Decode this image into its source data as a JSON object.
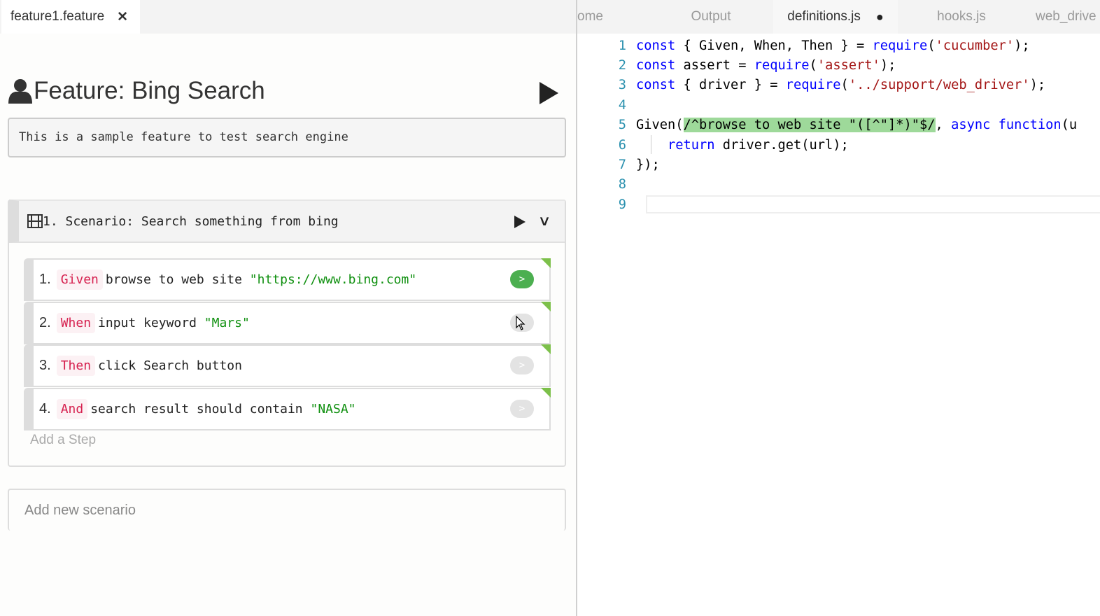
{
  "left_tab": {
    "label": "feature1.feature",
    "close": "✕"
  },
  "right_tabs": [
    {
      "label": "ome"
    },
    {
      "label": "Output"
    },
    {
      "label": "definitions.js",
      "modified": "●"
    },
    {
      "label": "hooks.js"
    },
    {
      "label": "web_drive"
    }
  ],
  "feature": {
    "title": "Feature: Bing Search",
    "description": "This is a sample feature to test search engine"
  },
  "scenario": {
    "title": "1. Scenario: Search something from bing",
    "chevron": "∨",
    "steps": [
      {
        "num": "1.",
        "keyword": "Given",
        "text": "browse to web site ",
        "arg": "\"https://www.bing.com\"",
        "status": "run"
      },
      {
        "num": "2.",
        "keyword": "When",
        "text": "input keyword ",
        "arg": "\"Mars\"",
        "status": "idle"
      },
      {
        "num": "3.",
        "keyword": "Then",
        "text": "click Search button",
        "arg": "",
        "status": "idle"
      },
      {
        "num": "4.",
        "keyword": "And",
        "text": "search result should contain ",
        "arg": "\"NASA\"",
        "status": "idle"
      }
    ],
    "run_glyph": ">",
    "add_step": "Add a Step"
  },
  "add_scenario": "Add new scenario",
  "code": {
    "lines": [
      "1",
      "2",
      "3",
      "4",
      "5",
      "6",
      "7",
      "8",
      "9"
    ],
    "l1": [
      "const",
      " { Given, When, Then } = ",
      "require",
      "(",
      "'cucumber'",
      ");"
    ],
    "l2": [
      "const",
      " assert = ",
      "require",
      "(",
      "'assert'",
      ");"
    ],
    "l3": [
      "const",
      " { driver } = ",
      "require",
      "(",
      "'../support/web_driver'",
      ");"
    ],
    "l5": [
      "Given(",
      "/^browse to web site \"([^\"]*)\"$/",
      ", ",
      "async",
      " ",
      "function",
      "(u"
    ],
    "l6": [
      "    ",
      "return",
      " driver.get(url);"
    ],
    "l7": "});"
  },
  "colors": {
    "keyword": "#0000ff",
    "string": "#a31515",
    "highlight": "#9ed99a",
    "step_keyword": "#d6204f",
    "step_arg": "#109010",
    "pass": "#4caf50"
  }
}
